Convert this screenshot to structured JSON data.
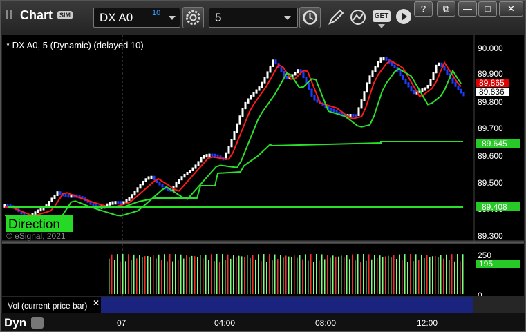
{
  "window": {
    "title": "Chart",
    "sim_badge": "SIM",
    "symbol": "DX A0",
    "delay_badge": "10",
    "interval": "5",
    "controls": {
      "help": "?",
      "restore": "⧉",
      "minimize": "—",
      "maximize": "□",
      "close": "✕"
    }
  },
  "chart": {
    "header": "* DX A0, 5 (Dynamic) (delayed 10)",
    "direction_label": "Direction",
    "copyright": "© eSignal, 2021",
    "price_axis": [
      "90.000",
      "89.900",
      "89.800",
      "89.700",
      "89.600",
      "89.500",
      "89.400",
      "89.300"
    ],
    "markers": {
      "red": "89.865",
      "white": "89.836",
      "green_upper": "89.645",
      "green_lower": "89.408"
    },
    "volume_axis": [
      "250",
      "0"
    ],
    "volume_marker": "195",
    "volume_label": "Vol (current price bar)",
    "close_label": "✕",
    "time_axis": [
      "07",
      "04:00",
      "08:00",
      "12:00"
    ]
  },
  "status": {
    "left_label": "Dyn"
  },
  "colors": {
    "background": "#000000",
    "up_bar": "#ffffff",
    "down_bar": "#1e3cff",
    "ma_red": "#ff1a1a",
    "ma_green": "#2be02b",
    "marker_red": "#e00000",
    "marker_green": "#26c926",
    "volume_bg": "#1a237e"
  }
}
